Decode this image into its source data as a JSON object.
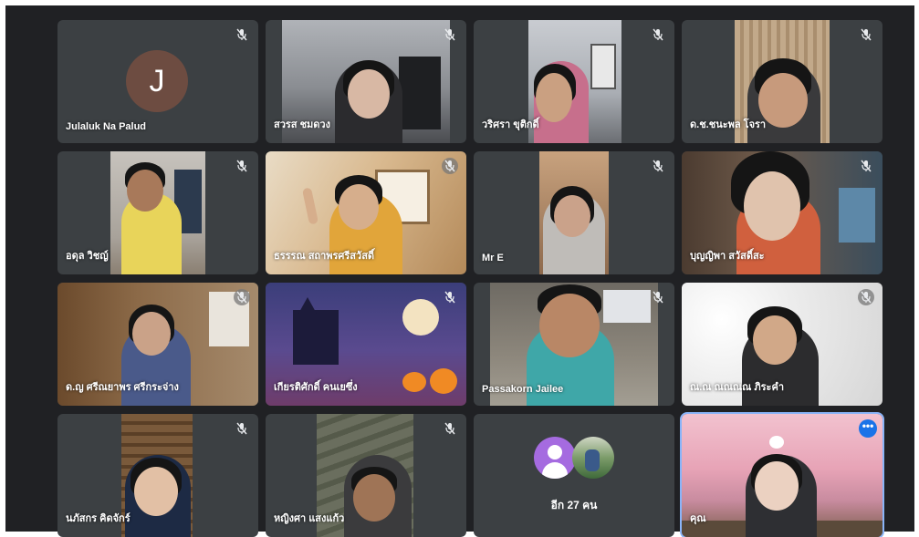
{
  "meeting": {
    "participants": [
      {
        "name": "Julaluk Na Palud",
        "avatar_letter": "J",
        "muted": true
      },
      {
        "name": "สวรส ชมดวง",
        "muted": true
      },
      {
        "name": "วริศรา ขุติกดิ์",
        "muted": true
      },
      {
        "name": "ด.ช.ชนะพล โจรา",
        "muted": true
      },
      {
        "name": "อดุล วิชญ์",
        "muted": true
      },
      {
        "name": "ธรรรณ สถาพรศรีสวัสดิ์",
        "muted": true
      },
      {
        "name": "Mr E",
        "muted": true
      },
      {
        "name": "บุญญิพา สวัสดิ์สะ",
        "muted": true
      },
      {
        "name": "ด.ญ ศรีณยาพร ศรีกระจ่าง",
        "muted": true
      },
      {
        "name": "เกียรติศักดิ์ คนเยซึ่ง",
        "muted": true
      },
      {
        "name": "Passakorn Jailee",
        "muted": true
      },
      {
        "name": "ณ.ณ ณณณณ ภิระคำ",
        "muted": true
      },
      {
        "name": "นภัสกร คิดจักร์",
        "muted": true
      },
      {
        "name": "หญิงศา แสงแก้ว",
        "muted": true
      },
      {
        "name": "คุณ",
        "muted": false
      }
    ],
    "others_label": "อีก 27 คน",
    "self_menu_icon": "more-options-icon",
    "colors": {
      "background": "#202124",
      "tile": "#3c4043",
      "avatar": "#6d4c41",
      "accent": "#1a73e8"
    }
  }
}
